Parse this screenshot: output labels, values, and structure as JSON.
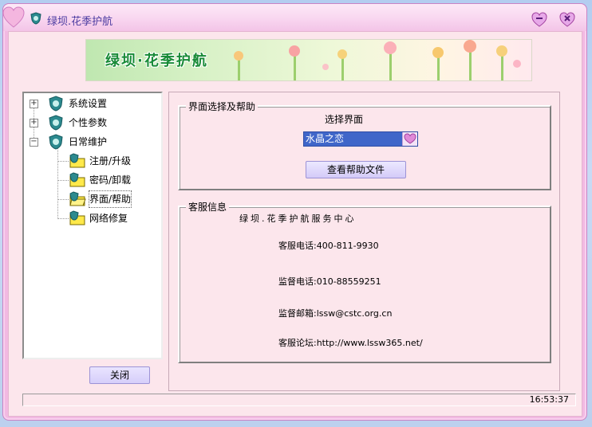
{
  "window": {
    "title": "绿坝.花季护航"
  },
  "banner": {
    "title": "绿坝·花季护航"
  },
  "tree": {
    "nodes": [
      {
        "label": "系统设置",
        "expander": "+"
      },
      {
        "label": "个性参数",
        "expander": "+"
      },
      {
        "label": "日常维护",
        "expander": "−"
      },
      {
        "label": "注册/升级"
      },
      {
        "label": "密码/卸载"
      },
      {
        "label": "界面/帮助",
        "selected": true
      },
      {
        "label": "网络修复"
      }
    ]
  },
  "close_button": {
    "label": "关闭"
  },
  "ui_group": {
    "legend": "界面选择及帮助",
    "select_label": "选择界面",
    "select_value": "水晶之恋",
    "help_button": "查看帮助文件"
  },
  "service_group": {
    "legend": "客服信息",
    "center": "绿坝.花季护航服务中心",
    "phone": "客服电话:400-811-9930",
    "supervise_phone": "监督电话:010-88559251",
    "supervise_email": "监督邮箱:lssw@cstc.org.cn",
    "forum": "客服论坛:http://www.lssw365.net/"
  },
  "status": {
    "time": "16:53:37"
  },
  "colors": {
    "window_frame": "#f2b9e2",
    "client_bg": "#fce6ec",
    "title_text": "#4a3aa0",
    "banner_text": "#178a36",
    "select_bg": "#3f66c9"
  }
}
